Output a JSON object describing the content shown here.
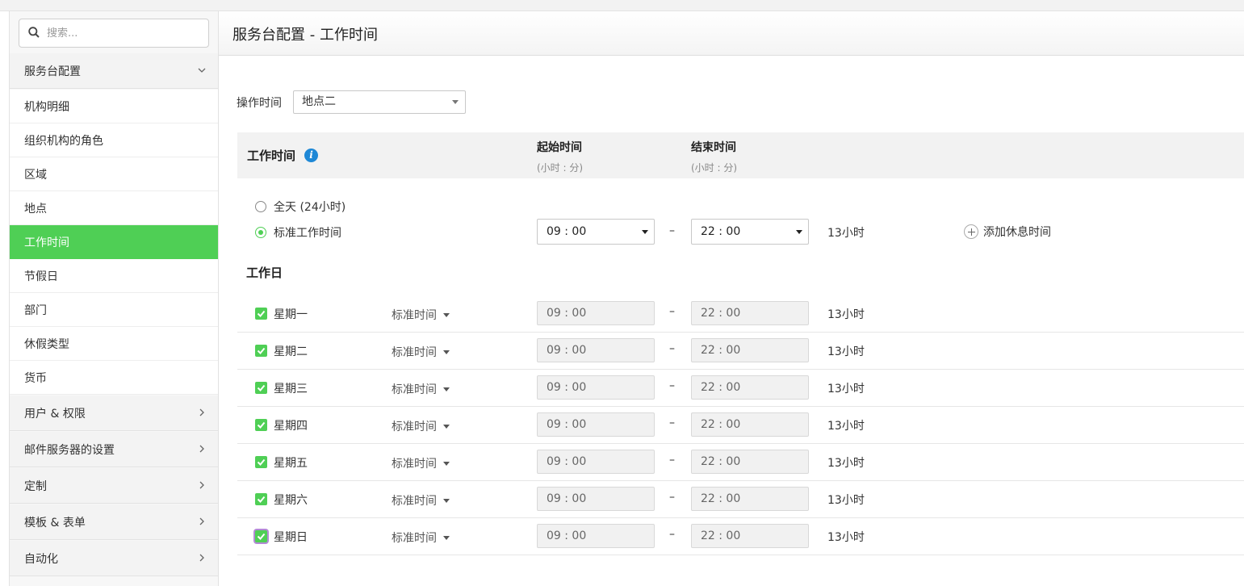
{
  "search": {
    "placeholder": "搜索..."
  },
  "sidebar": {
    "group_open": "服务台配置",
    "items": [
      "机构明细",
      "组织机构的角色",
      "区域",
      "地点",
      "工作时间",
      "节假日",
      "部门",
      "休假类型",
      "货币"
    ],
    "active_item": "工作时间",
    "collapsed_groups": [
      "用户 & 权限",
      "邮件服务器的设置",
      "定制",
      "模板 & 表单",
      "自动化"
    ]
  },
  "header": {
    "title": "服务台配置 - 工作时间"
  },
  "operation": {
    "label": "操作时间",
    "selected": "地点二"
  },
  "table": {
    "title": "工作时间",
    "start_header": "起始时间",
    "start_sub": "(小时 : 分)",
    "end_header": "结束时间",
    "end_sub": "(小时 : 分)"
  },
  "mode": {
    "allday_label": "全天 (24小时)",
    "standard_label": "标准工作时间",
    "selected": "standard",
    "start": "09 : 00",
    "end": "22 : 00",
    "dash": "–",
    "total": "13小时",
    "add_break": "添加休息时间"
  },
  "workdays": {
    "title": "工作日",
    "days": [
      {
        "name": "星期一",
        "checked": true,
        "mode": "标准时间",
        "start": "09 : 00",
        "end": "22 : 00",
        "total": "13小时"
      },
      {
        "name": "星期二",
        "checked": true,
        "mode": "标准时间",
        "start": "09 : 00",
        "end": "22 : 00",
        "total": "13小时"
      },
      {
        "name": "星期三",
        "checked": true,
        "mode": "标准时间",
        "start": "09 : 00",
        "end": "22 : 00",
        "total": "13小时"
      },
      {
        "name": "星期四",
        "checked": true,
        "mode": "标准时间",
        "start": "09 : 00",
        "end": "22 : 00",
        "total": "13小时"
      },
      {
        "name": "星期五",
        "checked": true,
        "mode": "标准时间",
        "start": "09 : 00",
        "end": "22 : 00",
        "total": "13小时"
      },
      {
        "name": "星期六",
        "checked": true,
        "mode": "标准时间",
        "start": "09 : 00",
        "end": "22 : 00",
        "total": "13小时"
      },
      {
        "name": "星期日",
        "checked": true,
        "mode": "标准时间",
        "start": "09 : 00",
        "end": "22 : 00",
        "total": "13小时"
      }
    ]
  },
  "colors": {
    "accent": "#4fcf55",
    "info": "#1e88d6"
  }
}
